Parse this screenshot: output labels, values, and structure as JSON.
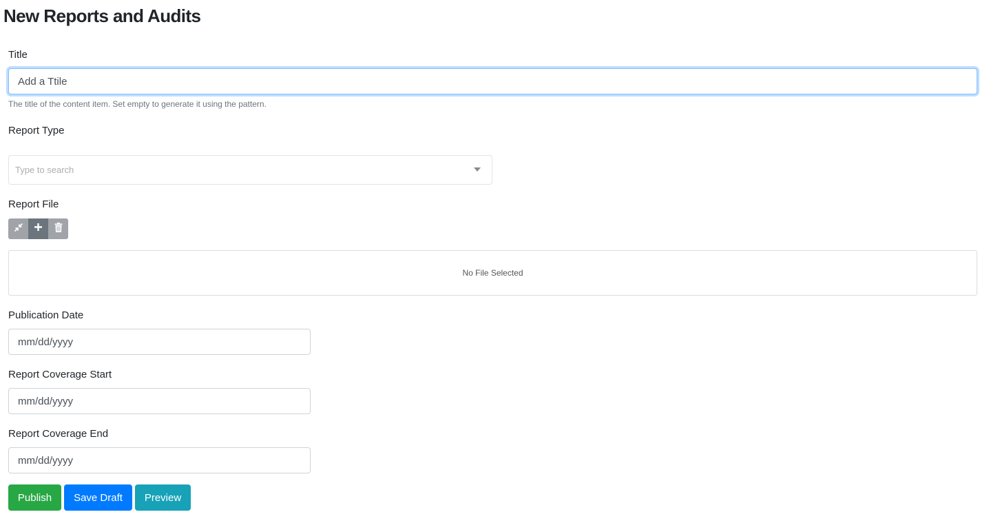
{
  "page": {
    "title": "New Reports and Audits"
  },
  "fields": {
    "title": {
      "label": "Title",
      "value": "Add a Ttile",
      "help": "The title of the content item. Set empty to generate it using the pattern."
    },
    "report_type": {
      "label": "Report Type",
      "placeholder": "Type to search"
    },
    "report_file": {
      "label": "Report File",
      "toolbar": [
        {
          "icon": "collapse-icon",
          "label": "Collapse"
        },
        {
          "icon": "plus-icon",
          "label": "Add"
        },
        {
          "icon": "trash-icon",
          "label": "Delete"
        }
      ],
      "empty_text": "No File Selected"
    },
    "publication_date": {
      "label": "Publication Date",
      "placeholder": "mm/dd/yyyy"
    },
    "coverage_start": {
      "label": "Report Coverage Start",
      "placeholder": "mm/dd/yyyy"
    },
    "coverage_end": {
      "label": "Report Coverage End",
      "placeholder": "mm/dd/yyyy"
    }
  },
  "actions": {
    "publish": "Publish",
    "save_draft": "Save Draft",
    "preview": "Preview"
  },
  "colors": {
    "publish": "#28a745",
    "save_draft": "#007bff",
    "preview": "#17a2b8",
    "focus_border": "#80bdff"
  }
}
